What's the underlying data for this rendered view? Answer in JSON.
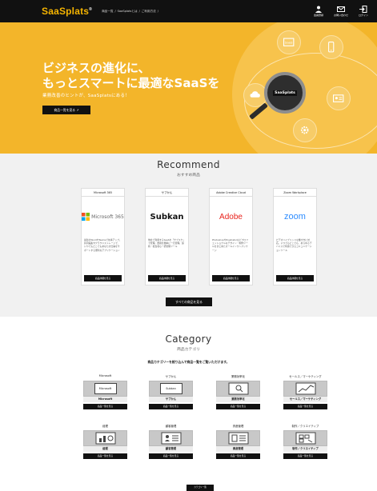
{
  "header": {
    "logo": "SaaSplats",
    "logo_mark": "®",
    "nav": [
      "商品一覧",
      "/",
      "SaaSplatsとは",
      "/",
      "ご利用方法",
      "/"
    ],
    "icons": [
      {
        "label": "会員登録",
        "icon": "user-icon"
      },
      {
        "label": "お問い合わせ",
        "icon": "mail-icon"
      },
      {
        "label": "ログイン",
        "icon": "login-icon"
      }
    ]
  },
  "hero": {
    "title_line1": "ビジネスの進化に、",
    "title_line2": "もっとスマートに最適なSaaSを",
    "subtitle": "業務改善のヒントが、SaaSplatsにある！",
    "button": "商品一覧を見る ↗",
    "center_badge": "SaaSplats",
    "bubble_text": "SaaS"
  },
  "recommend": {
    "title": "Recommend",
    "subtitle": "おすすめ商品",
    "cards": [
      {
        "name": "Microsoft 365",
        "logo": "Microsoft 365",
        "desc": "最新のWordやTeamsで効率アップ。共同編集やクラウドストレージで、いつでもどこでもあなたの仕事をサポートする便利なアプリケーション",
        "button": "商品詳細を見る"
      },
      {
        "name": "サブかん",
        "logo": "Subkan",
        "desc": "他社で利用するSaaSを「サブスク」で管理。費用を簡単に一元管理。契約・担当者も一括管理ツール",
        "button": "商品詳細を見る"
      },
      {
        "name": "Adobe Creative Cloud",
        "logo": "Adobe",
        "desc": "PhotoshopやIllustratorなどプロフェッショナルなデザイン・制作ツールをまとめたオールインワンパッケージ",
        "button": "商品詳細を見る"
      },
      {
        "name": "Zoom Workplace",
        "logo": "zoom",
        "desc": "ビデオハイブリッドな働き方に対応。いつでもどこでも、あらゆるデバイスで利用できるコミュニケーションツール",
        "button": "商品詳細を見る"
      }
    ],
    "all_button": "すべての商品を見る"
  },
  "category": {
    "title": "Category",
    "subtitle": "商品カテゴリ",
    "note": "商品カテゴリーを絞り込んで商品一覧をご覧いただけます。",
    "items": [
      {
        "cat": "Microsoft",
        "label": "Microsoft",
        "img": "Microsoft",
        "button": "商品一覧を見る"
      },
      {
        "cat": "サブかん",
        "label": "サブかん",
        "img": "Subkan",
        "button": "商品一覧を見る"
      },
      {
        "cat": "業務効率化",
        "label": "業務効率化",
        "img": "",
        "button": "商品一覧を見る"
      },
      {
        "cat": "セールス／マーケティング",
        "label": "セールス／マーケティング",
        "img": "",
        "button": "商品一覧を見る"
      },
      {
        "cat": "経理",
        "label": "経理",
        "img": "",
        "button": "商品一覧を見る"
      },
      {
        "cat": "顧客管理",
        "label": "顧客管理",
        "img": "",
        "button": "商品一覧を見る"
      },
      {
        "cat": "資産管理",
        "label": "資産管理",
        "img": "",
        "button": "商品一覧を見る"
      },
      {
        "cat": "制作／クリエイティブ",
        "label": "制作／クリエイティブ",
        "img": "",
        "button": "商品一覧を見る"
      }
    ],
    "bottom_button": "カテゴリ一覧"
  },
  "colors": {
    "accent": "#f3b52a",
    "dark": "#111111"
  }
}
